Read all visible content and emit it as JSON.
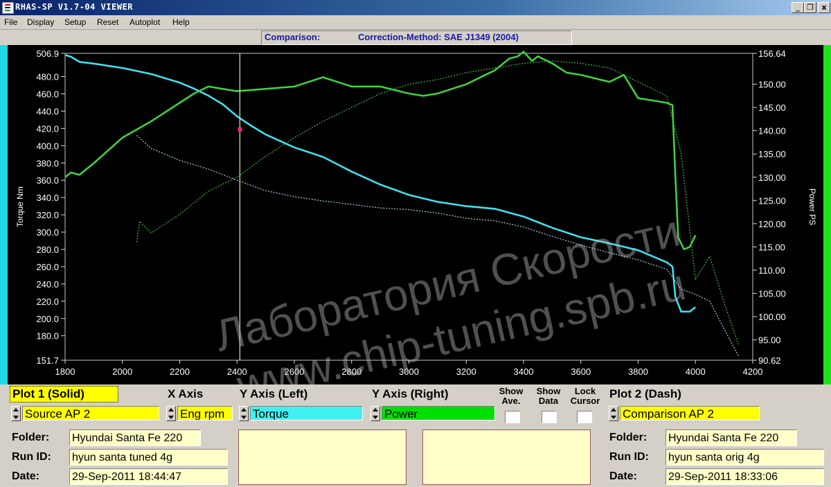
{
  "window": {
    "title": "RHAS-SP V1.7-04  VIEWER"
  },
  "menu": [
    "File",
    "Display",
    "Setup",
    "Reset",
    "Autoplot",
    "Help"
  ],
  "header": {
    "label": "Comparison:",
    "method": "Correction-Method: SAE J1349 (2004)"
  },
  "watermark": {
    "line1": "Лаборатория Скорости",
    "line2": "www.chip-tuning.spb.ru"
  },
  "chart_data": {
    "type": "line",
    "xlabel": "",
    "ylabel_left": "Torque Nm",
    "ylabel_right": "Power PS",
    "xlim": [
      1800,
      4200
    ],
    "ylim_left": [
      151.7,
      506.9
    ],
    "ylim_right": [
      90.62,
      156.64
    ],
    "x_ticks": [
      "1800",
      "2000",
      "2200",
      "2400",
      "2600",
      "2800",
      "3000",
      "3200",
      "3400",
      "3600",
      "3800",
      "4000",
      "4200"
    ],
    "y_left_ticks": [
      "506.9",
      "480.0",
      "460.0",
      "440.0",
      "420.0",
      "400.0",
      "380.0",
      "360.0",
      "340.0",
      "320.0",
      "300.0",
      "280.0",
      "260.0",
      "240.0",
      "220.0",
      "200.0",
      "180.0",
      "151.7"
    ],
    "y_right_ticks": [
      "156.64",
      "150.00",
      "145.00",
      "140.00",
      "135.00",
      "130.00",
      "125.00",
      "120.00",
      "115.00",
      "110.00",
      "105.00",
      "100.00",
      "95.00",
      "90.62"
    ],
    "cursor_rpm": 2410,
    "series": [
      {
        "color": "#40e0f0",
        "axis": "left",
        "style": "solid",
        "x": [
          1800,
          1820,
          1850,
          1900,
          2000,
          2100,
          2200,
          2250,
          2300,
          2350,
          2400,
          2450,
          2500,
          2600,
          2700,
          2800,
          2900,
          3000,
          3100,
          3200,
          3300,
          3400,
          3500,
          3600,
          3700,
          3800,
          3900,
          3920,
          3930,
          3950,
          3980,
          4000
        ],
        "y": [
          505,
          503,
          497,
          495,
          490,
          483,
          473,
          466,
          458,
          448,
          434,
          423,
          413,
          398,
          387,
          370,
          355,
          343,
          335,
          330,
          327,
          318,
          305,
          294,
          287,
          279,
          265,
          260,
          225,
          208,
          208,
          213
        ]
      },
      {
        "color": "#40d040",
        "axis": "right",
        "style": "solid",
        "x": [
          1800,
          1820,
          1850,
          1900,
          2000,
          2100,
          2200,
          2250,
          2300,
          2350,
          2400,
          2500,
          2600,
          2650,
          2700,
          2750,
          2800,
          2900,
          3000,
          3050,
          3100,
          3200,
          3300,
          3350,
          3380,
          3400,
          3430,
          3450,
          3500,
          3550,
          3600,
          3700,
          3750,
          3800,
          3850,
          3900,
          3920,
          3930,
          3940,
          3960,
          3980,
          4000
        ],
        "y": [
          130,
          131,
          130.5,
          133,
          138.5,
          142,
          146,
          148,
          149.5,
          149,
          148.5,
          149,
          149.5,
          150.5,
          151.5,
          150.5,
          149.5,
          149.5,
          148,
          147.5,
          148,
          150,
          153,
          155.5,
          156,
          157,
          155,
          156,
          154.5,
          152.5,
          152,
          150.5,
          152,
          147,
          146.5,
          146,
          145.5,
          130,
          117,
          114.5,
          115,
          117.5
        ]
      },
      {
        "color": "#a8d8e8",
        "axis": "left",
        "style": "dash",
        "x": [
          2050,
          2100,
          2200,
          2300,
          2400,
          2500,
          2600,
          2700,
          2800,
          2900,
          3000,
          3100,
          3200,
          3300,
          3400,
          3500,
          3600,
          3700,
          3800,
          3900,
          3950,
          4000,
          4050,
          4100,
          4150
        ],
        "y": [
          412,
          397,
          383,
          373,
          360,
          348,
          341,
          336,
          332,
          328,
          326,
          322,
          316,
          313,
          306,
          295,
          285,
          276,
          268,
          257,
          234,
          228,
          220,
          188,
          157
        ]
      },
      {
        "color": "#40c040",
        "axis": "right",
        "style": "dash",
        "x": [
          2050,
          2060,
          2100,
          2200,
          2300,
          2400,
          2500,
          2600,
          2700,
          2800,
          2900,
          3000,
          3100,
          3200,
          3300,
          3400,
          3500,
          3600,
          3700,
          3800,
          3900,
          3950,
          4000,
          4050,
          4100,
          4150
        ],
        "y": [
          116,
          120.5,
          118,
          122,
          127,
          130,
          134.5,
          138.5,
          142,
          145,
          148,
          150,
          151,
          152.5,
          153.5,
          154.5,
          155,
          154.5,
          153.5,
          150.5,
          147.5,
          135,
          108,
          113,
          103,
          94
        ]
      }
    ]
  },
  "controls": {
    "plot1_title": "Plot 1 (Solid)",
    "x_axis_title": "X Axis",
    "y_left_title": "Y Axis (Left)",
    "y_right_title": "Y Axis (Right)",
    "show_ave_1": "Show",
    "show_ave_2": "Ave.",
    "show_data_1": "Show",
    "show_data_2": "Data",
    "lock_cursor_1": "Lock",
    "lock_cursor_2": "Cursor",
    "plot2_title": "Plot 2 (Dash)",
    "plot1_source": "Source AP 2",
    "x_axis_value": "Eng rpm",
    "y_left_value": "Torque",
    "y_right_value": "Power",
    "plot2_source": "Comparison AP 2",
    "colors": {
      "yellow": "#ffff00",
      "cyan": "#40f0f0",
      "green": "#00e000"
    }
  },
  "plot1_info": {
    "folder_label": "Folder:",
    "folder": "Hyundai Santa Fe 220",
    "run_label": "Run ID:",
    "run": "hyun santa tuned 4g",
    "date_label": "Date:",
    "date": "29-Sep-2011  18:44:47"
  },
  "plot2_info": {
    "folder_label": "Folder:",
    "folder": "Hyundai Santa Fe 220",
    "run_label": "Run ID:",
    "run": "hyun santa orig 4g",
    "date_label": "Date:",
    "date": "29-Sep-2011  18:33:06"
  }
}
